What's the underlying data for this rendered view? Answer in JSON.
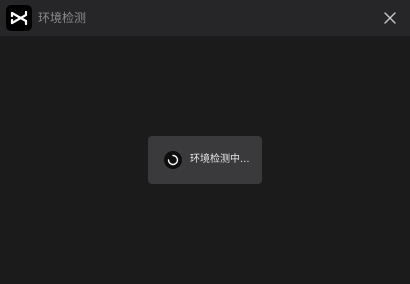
{
  "window": {
    "title": "环境检测",
    "logo_icon": "capcut-logo-icon",
    "close_icon": "close-icon"
  },
  "toast": {
    "message": "环境检测中...",
    "spinner_icon": "loading-spinner-icon"
  },
  "colors": {
    "background": "#1b1b1b",
    "titlebar": "#262628",
    "toast_background": "#3a3a3d",
    "title_text": "#8a8a8e",
    "toast_text": "#e6e6e6"
  }
}
